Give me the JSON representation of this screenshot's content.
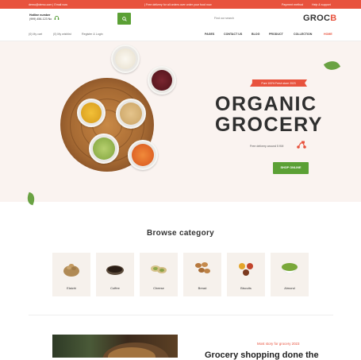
{
  "topbar": {
    "contact": "demo@demo.com | Email now",
    "promo": "| Free delivery for all orders over order your food now",
    "payment": "Payment method",
    "help": "Help & support"
  },
  "header": {
    "hotline_label": "Hotline number",
    "hotline_number": "(999) 456-123 No",
    "search_placeholder": "Find our search",
    "logo_text": "GROC",
    "logo_accent": "B"
  },
  "utility": {
    "cart": "(0) My cart",
    "wishlist": "(0) My wishlist",
    "account": "Register & Login"
  },
  "nav": {
    "items": [
      "HOME",
      "COLLECTION",
      "PRODUCT",
      "BLOG",
      "CONTACT US",
      "PAGES"
    ]
  },
  "hero": {
    "badge": "Pure 100% Fresh store 2023",
    "title_line1": "ORGANIC",
    "title_line2": "GROCERY",
    "delivery": "Free delivery around 5 KM",
    "cta": "SHOP ONLINE"
  },
  "browse": {
    "title": "Browse category",
    "categories": [
      {
        "name": "Elaichi",
        "icon": "cardamom-icon",
        "color": "#b08a55"
      },
      {
        "name": "Coffee",
        "icon": "coffee-icon",
        "color": "#3a2a20"
      },
      {
        "name": "Cheese",
        "icon": "pistachio-icon",
        "color": "#8fa84a"
      },
      {
        "name": "Bread",
        "icon": "nuts-icon",
        "color": "#b7793e"
      },
      {
        "name": "Biscuits",
        "icon": "spices-icon",
        "color": "#c2452c"
      },
      {
        "name": "Almond",
        "icon": "peas-icon",
        "color": "#7aa83a"
      }
    ]
  },
  "story": {
    "kicker": "Most story for grocery 2023",
    "title": "Grocery shopping done the"
  },
  "colors": {
    "accent": "#e8523d",
    "green": "#5ba035",
    "hero_bg": "#faf3f0"
  }
}
